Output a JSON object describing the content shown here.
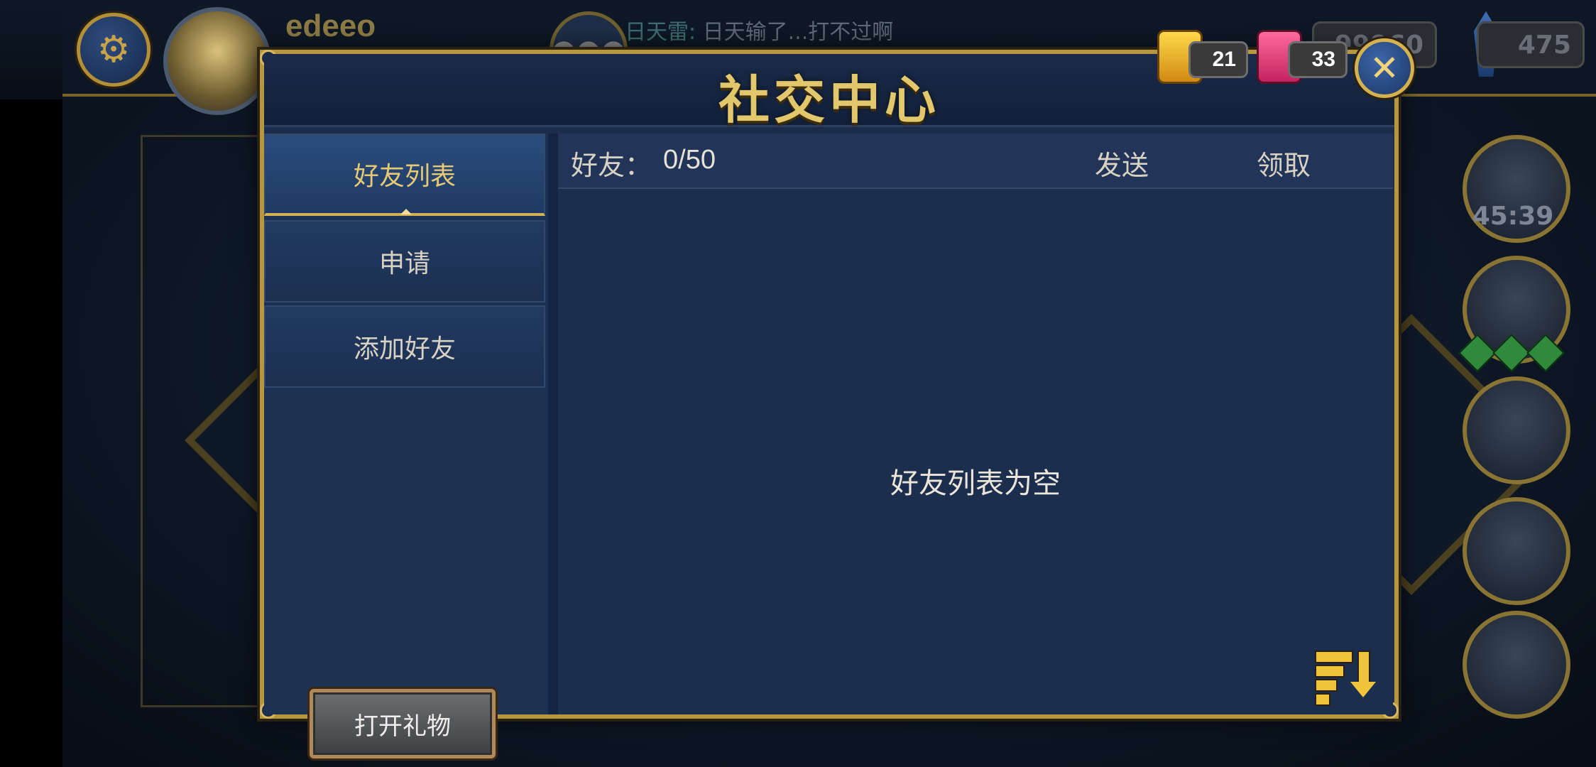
{
  "header": {
    "username": "edeeo",
    "chat_speaker": "日天雷:",
    "chat_message": " 日天输了...打不过啊",
    "coins": "99960",
    "gems": "475",
    "timer": "45:39"
  },
  "dialog": {
    "title": "社交中心",
    "gifts": {
      "gold_count": "21",
      "pink_count": "33"
    },
    "tabs": [
      {
        "label": "好友列表"
      },
      {
        "label": "申请"
      },
      {
        "label": "添加好友"
      }
    ],
    "open_gift_label": "打开礼物",
    "list_header": {
      "friends_label": "好友：",
      "friends_count": "0/50",
      "send_label": "发送",
      "receive_label": "领取"
    },
    "empty_message": "好友列表为空"
  },
  "colors": {
    "gold": "#e2c76c",
    "panel": "#1c2e4e",
    "border_gold": "#b8963e"
  }
}
